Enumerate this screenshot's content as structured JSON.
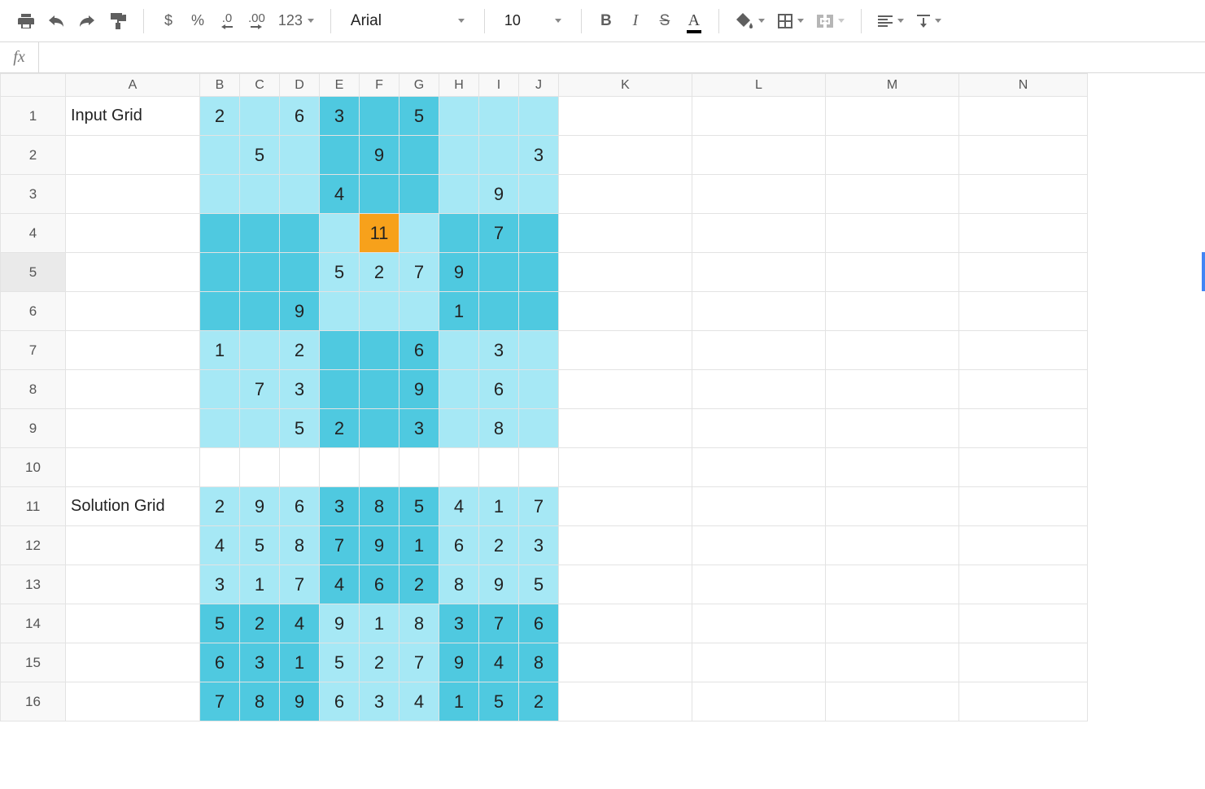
{
  "toolbar": {
    "currency": "$",
    "percent": "%",
    "dec_dec": ".0",
    "inc_dec": ".00",
    "more_formats": "123",
    "font_name": "Arial",
    "font_size": "10",
    "bold": "B",
    "italic": "I",
    "strike": "S",
    "text_color": "A"
  },
  "formula_bar": {
    "fx_label": "fx",
    "value": ""
  },
  "columns": [
    "A",
    "B",
    "C",
    "D",
    "E",
    "F",
    "G",
    "H",
    "I",
    "J",
    "K",
    "L",
    "M",
    "N"
  ],
  "row_count": 16,
  "selected_row": 5,
  "labels": {
    "input_grid": "Input Grid",
    "solution_grid": "Solution Grid"
  },
  "colors": {
    "light": "#a6e8f5",
    "dark": "#4fc9e0",
    "orange": "#f7a11b"
  },
  "cells": {
    "A1": {
      "v": "Input Grid",
      "cls": "colA"
    },
    "B1": {
      "v": "2",
      "c": "light"
    },
    "C1": {
      "v": "",
      "c": "light"
    },
    "D1": {
      "v": "6",
      "c": "light"
    },
    "E1": {
      "v": "3",
      "c": "dark"
    },
    "F1": {
      "v": "",
      "c": "dark"
    },
    "G1": {
      "v": "5",
      "c": "dark"
    },
    "H1": {
      "v": "",
      "c": "light"
    },
    "I1": {
      "v": "",
      "c": "light"
    },
    "J1": {
      "v": "",
      "c": "light"
    },
    "B2": {
      "v": "",
      "c": "light"
    },
    "C2": {
      "v": "5",
      "c": "light"
    },
    "D2": {
      "v": "",
      "c": "light"
    },
    "E2": {
      "v": "",
      "c": "dark"
    },
    "F2": {
      "v": "9",
      "c": "dark"
    },
    "G2": {
      "v": "",
      "c": "dark"
    },
    "H2": {
      "v": "",
      "c": "light"
    },
    "I2": {
      "v": "",
      "c": "light"
    },
    "J2": {
      "v": "3",
      "c": "light"
    },
    "B3": {
      "v": "",
      "c": "light"
    },
    "C3": {
      "v": "",
      "c": "light"
    },
    "D3": {
      "v": "",
      "c": "light"
    },
    "E3": {
      "v": "4",
      "c": "dark"
    },
    "F3": {
      "v": "",
      "c": "dark"
    },
    "G3": {
      "v": "",
      "c": "dark"
    },
    "H3": {
      "v": "",
      "c": "light"
    },
    "I3": {
      "v": "9",
      "c": "light"
    },
    "J3": {
      "v": "",
      "c": "light"
    },
    "B4": {
      "v": "",
      "c": "dark"
    },
    "C4": {
      "v": "",
      "c": "dark"
    },
    "D4": {
      "v": "",
      "c": "dark"
    },
    "E4": {
      "v": "",
      "c": "light"
    },
    "F4": {
      "v": "11",
      "c": "orange"
    },
    "G4": {
      "v": "",
      "c": "light"
    },
    "H4": {
      "v": "",
      "c": "dark"
    },
    "I4": {
      "v": "7",
      "c": "dark"
    },
    "J4": {
      "v": "",
      "c": "dark"
    },
    "B5": {
      "v": "",
      "c": "dark"
    },
    "C5": {
      "v": "",
      "c": "dark"
    },
    "D5": {
      "v": "",
      "c": "dark"
    },
    "E5": {
      "v": "5",
      "c": "light"
    },
    "F5": {
      "v": "2",
      "c": "light"
    },
    "G5": {
      "v": "7",
      "c": "light"
    },
    "H5": {
      "v": "9",
      "c": "dark"
    },
    "I5": {
      "v": "",
      "c": "dark"
    },
    "J5": {
      "v": "",
      "c": "dark"
    },
    "B6": {
      "v": "",
      "c": "dark"
    },
    "C6": {
      "v": "",
      "c": "dark"
    },
    "D6": {
      "v": "9",
      "c": "dark"
    },
    "E6": {
      "v": "",
      "c": "light"
    },
    "F6": {
      "v": "",
      "c": "light"
    },
    "G6": {
      "v": "",
      "c": "light"
    },
    "H6": {
      "v": "1",
      "c": "dark"
    },
    "I6": {
      "v": "",
      "c": "dark"
    },
    "J6": {
      "v": "",
      "c": "dark"
    },
    "B7": {
      "v": "1",
      "c": "light"
    },
    "C7": {
      "v": "",
      "c": "light"
    },
    "D7": {
      "v": "2",
      "c": "light"
    },
    "E7": {
      "v": "",
      "c": "dark"
    },
    "F7": {
      "v": "",
      "c": "dark"
    },
    "G7": {
      "v": "6",
      "c": "dark"
    },
    "H7": {
      "v": "",
      "c": "light"
    },
    "I7": {
      "v": "3",
      "c": "light"
    },
    "J7": {
      "v": "",
      "c": "light"
    },
    "B8": {
      "v": "",
      "c": "light"
    },
    "C8": {
      "v": "7",
      "c": "light"
    },
    "D8": {
      "v": "3",
      "c": "light"
    },
    "E8": {
      "v": "",
      "c": "dark"
    },
    "F8": {
      "v": "",
      "c": "dark"
    },
    "G8": {
      "v": "9",
      "c": "dark"
    },
    "H8": {
      "v": "",
      "c": "light"
    },
    "I8": {
      "v": "6",
      "c": "light"
    },
    "J8": {
      "v": "",
      "c": "light"
    },
    "B9": {
      "v": "",
      "c": "light"
    },
    "C9": {
      "v": "",
      "c": "light"
    },
    "D9": {
      "v": "5",
      "c": "light"
    },
    "E9": {
      "v": "2",
      "c": "dark"
    },
    "F9": {
      "v": "",
      "c": "dark"
    },
    "G9": {
      "v": "3",
      "c": "dark"
    },
    "H9": {
      "v": "",
      "c": "light"
    },
    "I9": {
      "v": "8",
      "c": "light"
    },
    "J9": {
      "v": "",
      "c": "light"
    },
    "A11": {
      "v": "Solution Grid",
      "cls": "colA"
    },
    "B11": {
      "v": "2",
      "c": "light"
    },
    "C11": {
      "v": "9",
      "c": "light"
    },
    "D11": {
      "v": "6",
      "c": "light"
    },
    "E11": {
      "v": "3",
      "c": "dark"
    },
    "F11": {
      "v": "8",
      "c": "dark"
    },
    "G11": {
      "v": "5",
      "c": "dark"
    },
    "H11": {
      "v": "4",
      "c": "light"
    },
    "I11": {
      "v": "1",
      "c": "light"
    },
    "J11": {
      "v": "7",
      "c": "light"
    },
    "B12": {
      "v": "4",
      "c": "light"
    },
    "C12": {
      "v": "5",
      "c": "light"
    },
    "D12": {
      "v": "8",
      "c": "light"
    },
    "E12": {
      "v": "7",
      "c": "dark"
    },
    "F12": {
      "v": "9",
      "c": "dark"
    },
    "G12": {
      "v": "1",
      "c": "dark"
    },
    "H12": {
      "v": "6",
      "c": "light"
    },
    "I12": {
      "v": "2",
      "c": "light"
    },
    "J12": {
      "v": "3",
      "c": "light"
    },
    "B13": {
      "v": "3",
      "c": "light"
    },
    "C13": {
      "v": "1",
      "c": "light"
    },
    "D13": {
      "v": "7",
      "c": "light"
    },
    "E13": {
      "v": "4",
      "c": "dark"
    },
    "F13": {
      "v": "6",
      "c": "dark"
    },
    "G13": {
      "v": "2",
      "c": "dark"
    },
    "H13": {
      "v": "8",
      "c": "light"
    },
    "I13": {
      "v": "9",
      "c": "light"
    },
    "J13": {
      "v": "5",
      "c": "light"
    },
    "B14": {
      "v": "5",
      "c": "dark"
    },
    "C14": {
      "v": "2",
      "c": "dark"
    },
    "D14": {
      "v": "4",
      "c": "dark"
    },
    "E14": {
      "v": "9",
      "c": "light"
    },
    "F14": {
      "v": "1",
      "c": "light"
    },
    "G14": {
      "v": "8",
      "c": "light"
    },
    "H14": {
      "v": "3",
      "c": "dark"
    },
    "I14": {
      "v": "7",
      "c": "dark"
    },
    "J14": {
      "v": "6",
      "c": "dark"
    },
    "B15": {
      "v": "6",
      "c": "dark"
    },
    "C15": {
      "v": "3",
      "c": "dark"
    },
    "D15": {
      "v": "1",
      "c": "dark"
    },
    "E15": {
      "v": "5",
      "c": "light"
    },
    "F15": {
      "v": "2",
      "c": "light"
    },
    "G15": {
      "v": "7",
      "c": "light"
    },
    "H15": {
      "v": "9",
      "c": "dark"
    },
    "I15": {
      "v": "4",
      "c": "dark"
    },
    "J15": {
      "v": "8",
      "c": "dark"
    },
    "B16": {
      "v": "7",
      "c": "dark"
    },
    "C16": {
      "v": "8",
      "c": "dark"
    },
    "D16": {
      "v": "9",
      "c": "dark"
    },
    "E16": {
      "v": "6",
      "c": "light"
    },
    "F16": {
      "v": "3",
      "c": "light"
    },
    "G16": {
      "v": "4",
      "c": "light"
    },
    "H16": {
      "v": "1",
      "c": "dark"
    },
    "I16": {
      "v": "5",
      "c": "dark"
    },
    "J16": {
      "v": "2",
      "c": "dark"
    }
  }
}
